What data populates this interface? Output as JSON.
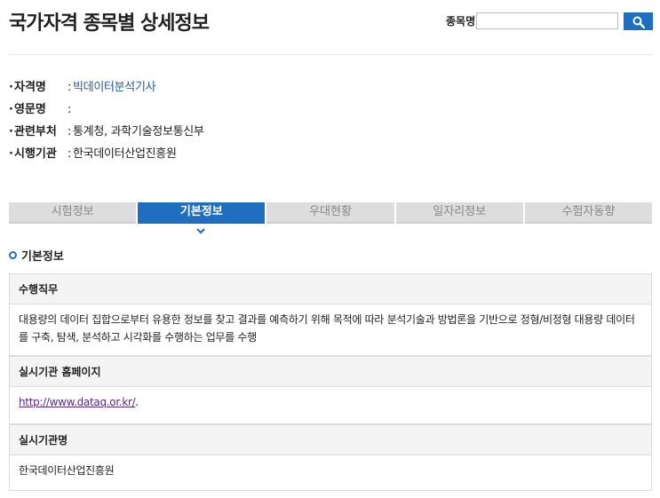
{
  "page": {
    "title": "국가자격 종목별 상세정보"
  },
  "search": {
    "label": "종목명",
    "value": "",
    "placeholder": ""
  },
  "info": [
    {
      "key": "자격명",
      "value": "빅데이터분석기사"
    },
    {
      "key": "영문명",
      "value": ""
    },
    {
      "key": "관련부처",
      "value": "통계청, 과학기술정보통신부"
    },
    {
      "key": "시행기관",
      "value": "한국데이터산업진흥원"
    }
  ],
  "tabs": [
    {
      "label": "시험정보",
      "active": false
    },
    {
      "label": "기본정보",
      "active": true
    },
    {
      "label": "우대현황",
      "active": false
    },
    {
      "label": "일자리정보",
      "active": false
    },
    {
      "label": "수험자동향",
      "active": false
    }
  ],
  "section": {
    "title": "기본정보"
  },
  "boxes": {
    "duty": {
      "head": "수행직무",
      "body": "대용량의 데이터 집합으로부터 유용한 정보를 찾고 결과를 예측하기 위해 목적에 따라 분석기술과 방법론을 기반으로 정형/비정형 대용량 데이터를 구축, 탐색, 분석하고 시각화를 수행하는 업무를 수행"
    },
    "homepage": {
      "head": "실시기관 홈페이지",
      "link": "http://www.dataq.or.kr/",
      "suffix": "."
    },
    "org": {
      "head": "실시기관명",
      "body": "한국데이터산업진흥원"
    }
  },
  "colors": {
    "accent": "#1f6fc0",
    "link": "#1f5fa8",
    "visited": "#5a2a8a"
  }
}
